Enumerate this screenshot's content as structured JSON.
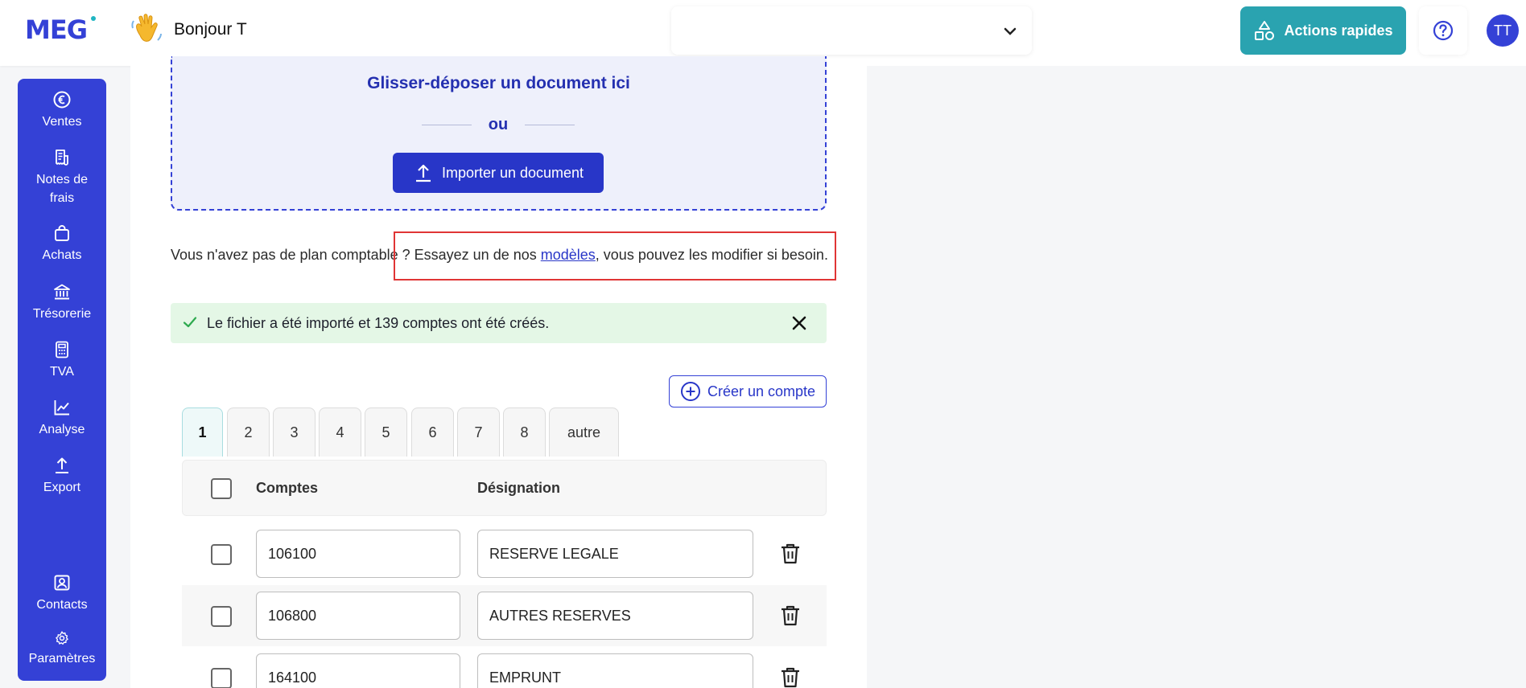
{
  "header": {
    "logo": "MEG",
    "greeting": "Bonjour T",
    "company_selector_value": "",
    "quick_actions_label": "Actions rapides",
    "avatar_initials": "TT"
  },
  "sidebar": {
    "items": [
      {
        "label": "Ventes",
        "icon": "euro-icon"
      },
      {
        "label": "Notes de frais",
        "icon": "receipt-icon"
      },
      {
        "label": "Achats",
        "icon": "shopping-bag-icon"
      },
      {
        "label": "Trésorerie",
        "icon": "bank-icon"
      },
      {
        "label": "TVA",
        "icon": "calculator-icon"
      },
      {
        "label": "Analyse",
        "icon": "chart-line-icon"
      },
      {
        "label": "Export",
        "icon": "upload-icon"
      },
      {
        "label": "Contacts",
        "icon": "contact-card-icon"
      },
      {
        "label": "Paramètres",
        "icon": "gear-icon"
      }
    ]
  },
  "upload": {
    "title": "Glisser-déposer un document ici",
    "or_label": "ou",
    "import_button_label": "Importer un document"
  },
  "hint": {
    "before": "Vous n'avez pas de plan comptable ? Essayez un de nos ",
    "link": "modèles",
    "after": ", vous pouvez les modifier si besoin."
  },
  "alert": {
    "message": "Le fichier a été importé et 139 comptes ont été créés."
  },
  "create_account_label": "Créer un compte",
  "tabs": [
    "1",
    "2",
    "3",
    "4",
    "5",
    "6",
    "7",
    "8",
    "autre"
  ],
  "active_tab": "1",
  "table": {
    "columns": [
      "Comptes",
      "Désignation"
    ],
    "rows": [
      {
        "account": "106100",
        "designation": "RESERVE LEGALE"
      },
      {
        "account": "106800",
        "designation": "AUTRES RESERVES"
      },
      {
        "account": "164100",
        "designation": "EMPRUNT"
      }
    ]
  },
  "colors": {
    "brand": "#3441d6",
    "accent": "#2aa3b0",
    "success_bg": "#e4f7e6",
    "highlight": "#e03535"
  }
}
